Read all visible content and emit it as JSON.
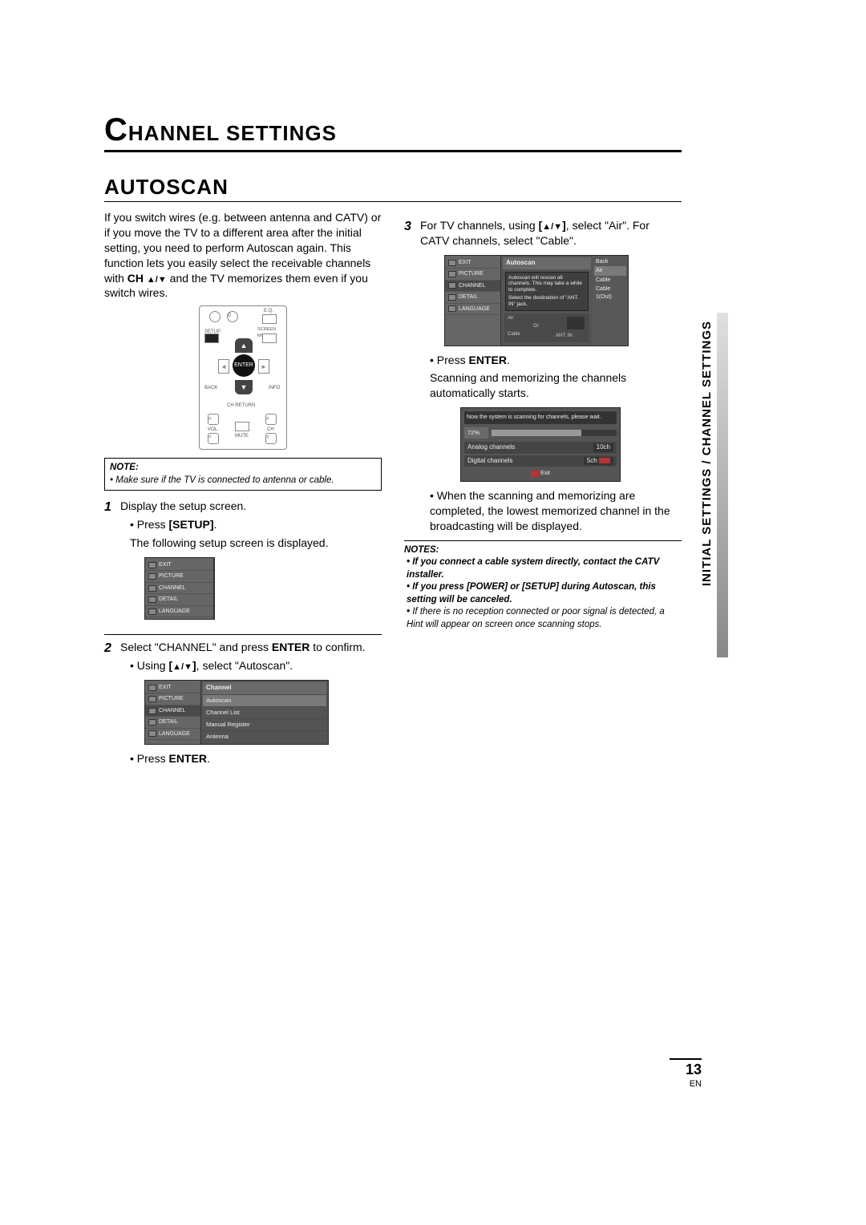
{
  "chapter": {
    "first_letter": "C",
    "rest": "HANNEL SETTINGS"
  },
  "section_title": "AUTOSCAN",
  "intro": {
    "p1a": "If you switch wires (e.g. between antenna and CATV) or if you move the TV to a different area after the initial setting, you need to perform Autoscan again. This function lets you easily select the receivable channels with ",
    "bold_ch": "CH ",
    "p1b": " and the TV memorizes them even if you switch wires."
  },
  "remote": {
    "labels": {
      "setup": "SETUP",
      "screen_mode": "SCREEN MODE",
      "eq": "E.Q.",
      "back": "BACK",
      "info": "INFO",
      "ch_return": "CH RETURN",
      "vol": "VOL.",
      "mute": "MUTE",
      "ch": "CH",
      "enter": "ENTER"
    }
  },
  "note1": {
    "head": "NOTE:",
    "text": "Make sure if the TV is connected to antenna or cable."
  },
  "steps": {
    "s1": {
      "num": "1",
      "line1": "Display the setup screen.",
      "bullet_a": "Press ",
      "bullet_bold": "[SETUP]",
      "bullet_b": ".",
      "line2": "The following setup screen is displayed."
    },
    "s2": {
      "num": "2",
      "line1a": "Select \"CHANNEL\" and press ",
      "line1bold": "ENTER",
      "line1b": " to confirm.",
      "bullet_a": "Using ",
      "bullet_bold": "[",
      "bullet_b2": "]",
      "bullet_b": ", select \"Autoscan\".",
      "after": "Press ",
      "after_bold": "ENTER",
      "after_b": "."
    },
    "s3": {
      "num": "3",
      "line1a": "For TV channels, using ",
      "line1bold": "[",
      "line1b2": "]",
      "line1b": ", select \"Air\". For CATV channels, select \"Cable\".",
      "bullet_a": "Press ",
      "bullet_bold": "ENTER",
      "bullet_b": ".",
      "line2": "Scanning and memorizing the channels automatically starts.",
      "closing": "When the scanning and memorizing are completed, the lowest memorized channel in the broadcasting will be displayed."
    }
  },
  "osd_side_items": [
    "EXIT",
    "PICTURE",
    "CHANNEL",
    "DETAIL",
    "LANGUAGE"
  ],
  "osd2": {
    "header": "Channel",
    "items": [
      "Autoscan",
      "Channel List",
      "Manual Register",
      "Antenna"
    ]
  },
  "osd3": {
    "header": "Autoscan",
    "info1": "Autoscan will rescan all channels. This may take a while to complete.",
    "info2": "Select the destination of \"ANT. IN\" jack.",
    "right": [
      "Back",
      "Air",
      "Cable",
      "Cable 1(Out)"
    ],
    "graphic": {
      "air": "Air",
      "cable": "Cable",
      "or": "Or",
      "ant": "ANT. IN"
    }
  },
  "scan": {
    "msg": "Now the system is scanning for channels, please wait.",
    "pct_label": "72%",
    "pct_value": 72,
    "rows": [
      {
        "label": "Analog channels",
        "val": "10ch"
      },
      {
        "label": "Digital channels",
        "val": "5ch"
      }
    ],
    "exit": "Exit"
  },
  "notes2": {
    "head": "NOTES:",
    "items": [
      "If you connect a cable system directly, contact the CATV installer.",
      "If you press [POWER] or [SETUP] during Autoscan, this setting will be canceled.",
      "If there is no reception connected or poor signal is detected, a Hint will appear on screen once scanning stops."
    ]
  },
  "sidetab": "INITIAL SETTINGS / CHANNEL SETTINGS",
  "page_number": "13",
  "page_lang": "EN"
}
